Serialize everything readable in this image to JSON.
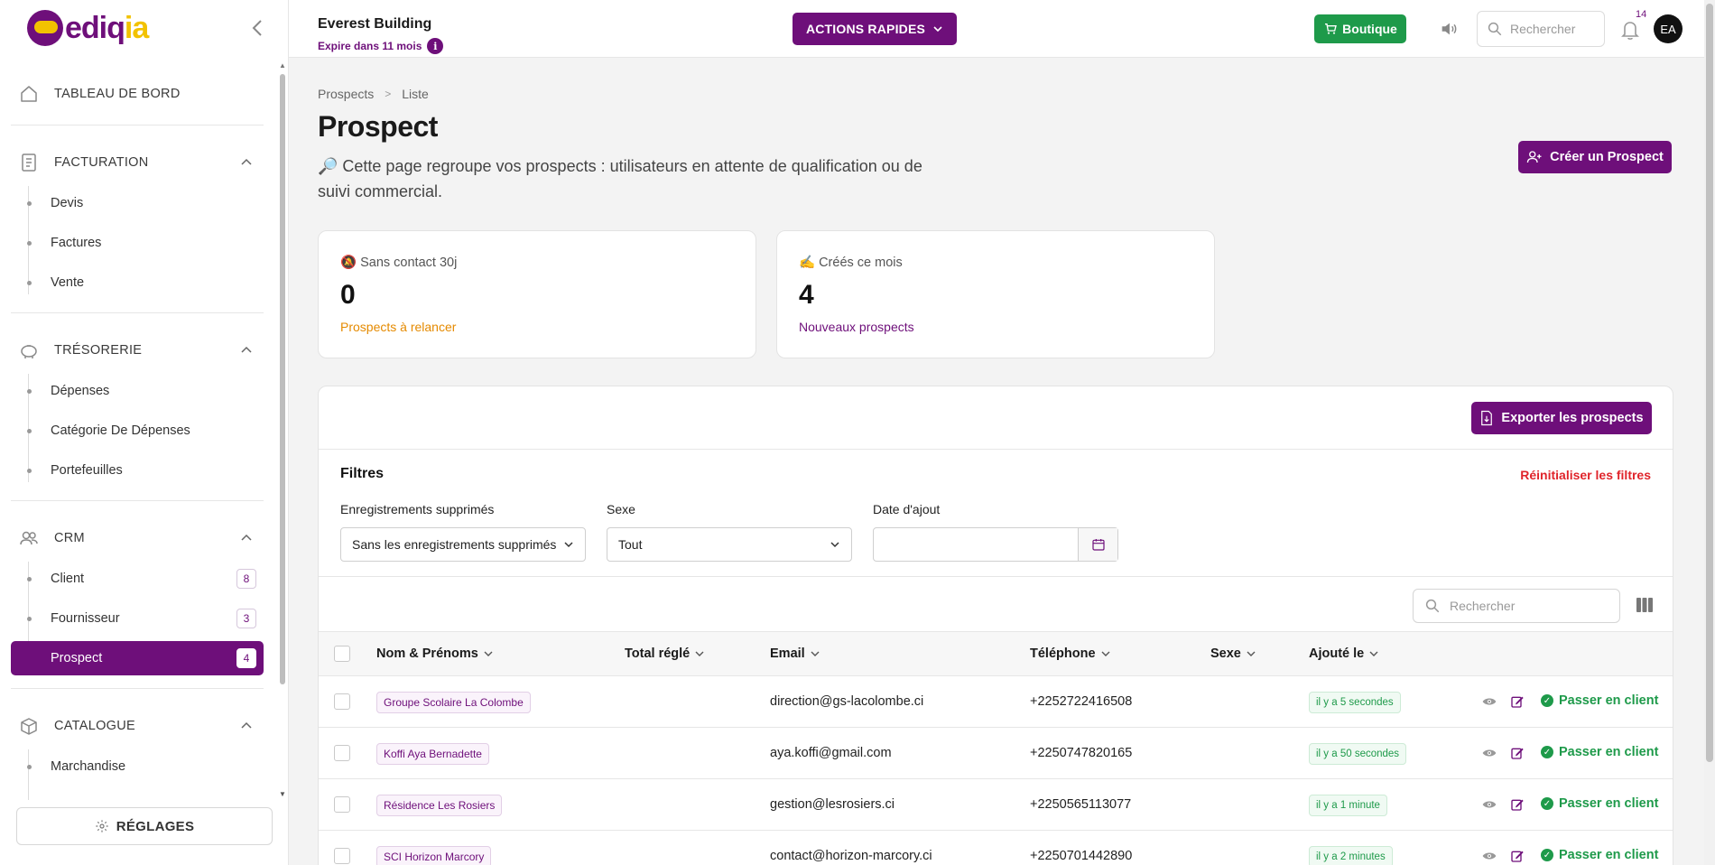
{
  "brand": {
    "logo_text_main": "ediq",
    "logo_text_accent": "ia",
    "accent_color": "#6e0f7a",
    "logo_yellow": "#f2c200"
  },
  "sidebar": {
    "dashboard": {
      "label": "TABLEAU DE BORD",
      "icon": "home-icon"
    },
    "sections": [
      {
        "label": "FACTURATION",
        "icon": "invoice-icon",
        "items": [
          {
            "label": "Devis"
          },
          {
            "label": "Factures"
          },
          {
            "label": "Vente"
          }
        ]
      },
      {
        "label": "TRÉSORERIE",
        "icon": "piggy-bank-icon",
        "items": [
          {
            "label": "Dépenses"
          },
          {
            "label": "Catégorie De Dépenses"
          },
          {
            "label": "Portefeuilles"
          }
        ]
      },
      {
        "label": "CRM",
        "icon": "users-icon",
        "items": [
          {
            "label": "Client",
            "badge": "8"
          },
          {
            "label": "Fournisseur",
            "badge": "3"
          },
          {
            "label": "Prospect",
            "badge": "4",
            "active": true
          }
        ]
      },
      {
        "label": "CATALOGUE",
        "icon": "box-icon",
        "items": [
          {
            "label": "Marchandise"
          }
        ]
      }
    ],
    "settings_label": "RÉGLAGES"
  },
  "topbar": {
    "company": "Everest Building",
    "expire": "Expire dans 11 mois",
    "quick_actions": "ACTIONS RAPIDES",
    "shop": "Boutique",
    "search_placeholder": "Rechercher",
    "notifications_count": "14",
    "avatar_initials": "EA"
  },
  "breadcrumb": {
    "root": "Prospects",
    "current": "Liste"
  },
  "page": {
    "title": "Prospect",
    "description": "🔎 Cette page regroupe vos prospects : utilisateurs en attente de qualification ou de suivi commercial.",
    "create_button": "Créer un Prospect"
  },
  "stats": [
    {
      "label": "🔕 Sans contact 30j",
      "value": "0",
      "sub": "Prospects à relancer",
      "sub_color": "#e58a00"
    },
    {
      "label": "✍️ Créés ce mois",
      "value": "4",
      "sub": "Nouveaux prospects",
      "sub_color": "#6e0f7a"
    }
  ],
  "panel": {
    "export_button": "Exporter les prospects",
    "filters_title": "Filtres",
    "reset_filters": "Réinitialiser les filtres",
    "filters": [
      {
        "label": "Enregistrements supprimés",
        "value": "Sans les enregistrements supprimés"
      },
      {
        "label": "Sexe",
        "value": "Tout"
      },
      {
        "label": "Date d'ajout",
        "value": ""
      }
    ],
    "table_search_placeholder": "Rechercher"
  },
  "table": {
    "columns": [
      "Nom & Prénoms",
      "Total réglé",
      "Email",
      "Téléphone",
      "Sexe",
      "Ajouté le"
    ],
    "action_label": "Passer en client",
    "rows": [
      {
        "name": "Groupe Scolaire La Colombe",
        "total": "",
        "email": "direction@gs-lacolombe.ci",
        "phone": "+2252722416508",
        "sexe": "",
        "added": "il y a 5 secondes"
      },
      {
        "name": "Koffi Aya Bernadette",
        "total": "",
        "email": "aya.koffi@gmail.com",
        "phone": "+2250747820165",
        "sexe": "",
        "added": "il y a 50 secondes"
      },
      {
        "name": "Résidence Les Rosiers",
        "total": "",
        "email": "gestion@lesrosiers.ci",
        "phone": "+2250565113077",
        "sexe": "",
        "added": "il y a 1 minute"
      },
      {
        "name": "SCI Horizon Marcory",
        "total": "",
        "email": "contact@horizon-marcory.ci",
        "phone": "+2250701442890",
        "sexe": "",
        "added": "il y a 2 minutes"
      }
    ]
  }
}
